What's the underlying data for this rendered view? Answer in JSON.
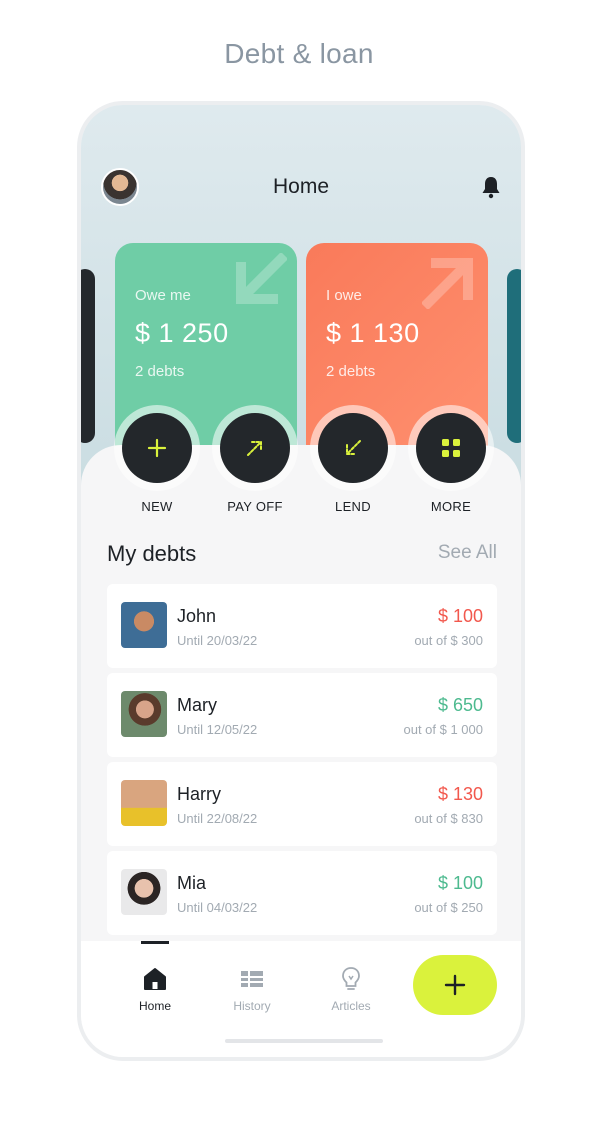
{
  "caption": "Debt & loan",
  "header": {
    "title": "Home"
  },
  "cards": [
    {
      "label": "Owe me",
      "amount": "$ 1 250",
      "sub": "2 debts",
      "color": "#6fcda6"
    },
    {
      "label": "I owe",
      "amount": "$ 1 130",
      "sub": "2 debts",
      "color": "#f97a5a"
    }
  ],
  "actions": [
    {
      "label": "NEW",
      "icon": "plus-icon"
    },
    {
      "label": "PAY OFF",
      "icon": "arrow-up-right-icon"
    },
    {
      "label": "LEND",
      "icon": "arrow-down-left-icon"
    },
    {
      "label": "MORE",
      "icon": "grid-icon"
    }
  ],
  "section": {
    "title": "My debts",
    "link": "See All"
  },
  "debts": [
    {
      "name": "John",
      "date": "Until 20/03/22",
      "amount": "$ 100",
      "total": "out of $ 300",
      "status": "red"
    },
    {
      "name": "Mary",
      "date": "Until 12/05/22",
      "amount": "$ 650",
      "total": "out of $ 1 000",
      "status": "green"
    },
    {
      "name": "Harry",
      "date": "Until 22/08/22",
      "amount": "$ 130",
      "total": "out of $ 830",
      "status": "red"
    },
    {
      "name": "Mia",
      "date": "Until 04/03/22",
      "amount": "$ 100",
      "total": "out of $ 250",
      "status": "green"
    }
  ],
  "nav": [
    {
      "label": "Home",
      "icon": "home-icon"
    },
    {
      "label": "History",
      "icon": "list-icon"
    },
    {
      "label": "Articles",
      "icon": "lightbulb-icon"
    }
  ],
  "colors": {
    "accent": "#daf23c",
    "dark": "#23272b",
    "red": "#f2584d",
    "green": "#4dba8f"
  }
}
